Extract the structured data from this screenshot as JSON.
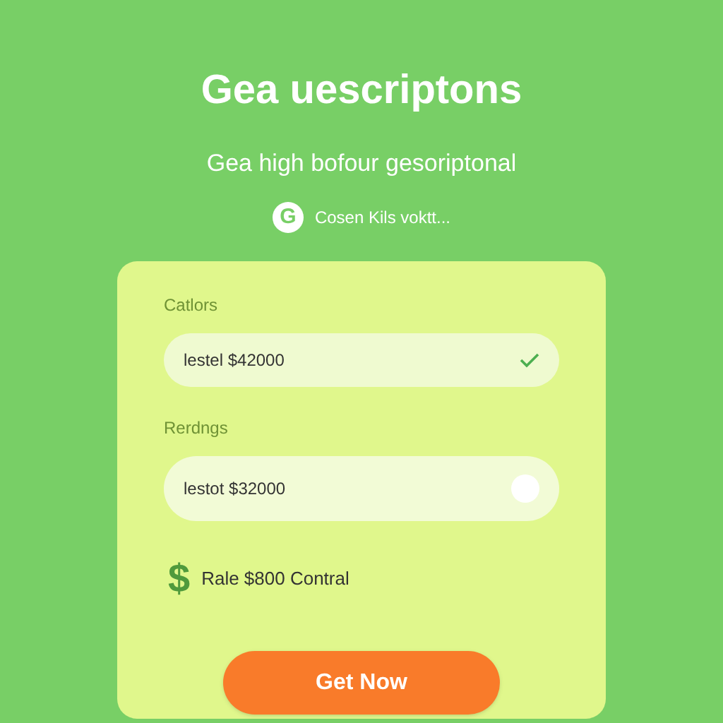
{
  "title": "Gea uescriptons",
  "subtitle": "Gea high bofour gesoriptonal",
  "badge": {
    "icon": "G",
    "text": "Cosen Kils voktt..."
  },
  "fields": [
    {
      "label": "Catlors",
      "value": "lestel $42000",
      "kind": "check"
    },
    {
      "label": "Rerdngs",
      "value": "lestot $32000",
      "kind": "dot"
    }
  ],
  "note": {
    "icon": "$",
    "text": "Rale $800 Contral"
  },
  "button": "Get Now"
}
